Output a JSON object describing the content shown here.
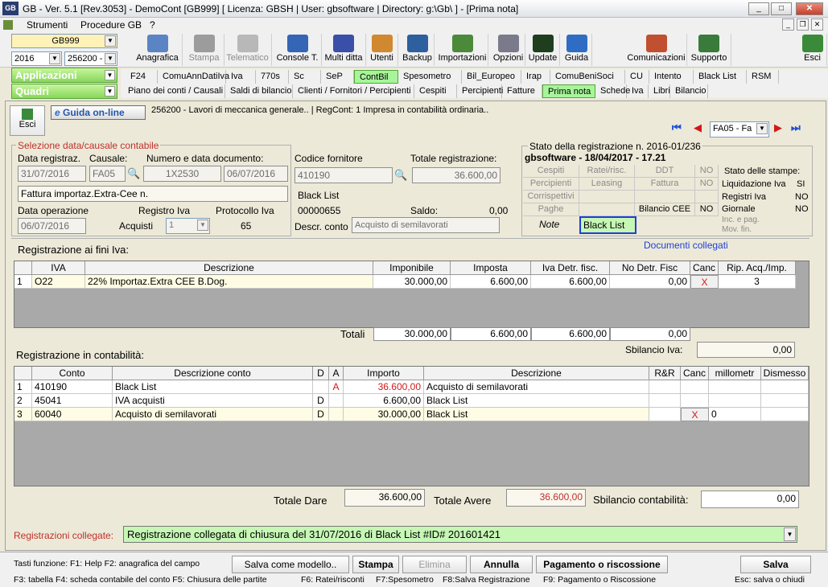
{
  "window": {
    "title": "GB - Ver. 5.1 [Rev.3053] - DemoCont [GB999]    [ Licenza: GBSH | User: gbsoftware | Directory: g:\\Gb\\ ] - [Prima nota]",
    "logo": "GB",
    "minimize": "_",
    "maximize": "□",
    "close": "✕"
  },
  "menu": {
    "items": [
      "Strumenti",
      "Procedure GB",
      "?"
    ],
    "inner_min": "_",
    "inner_restore": "❐",
    "inner_close": "✕"
  },
  "toolbar": {
    "company": "GB999",
    "year": "2016",
    "code": "256200 -",
    "buttons": [
      {
        "label": "Anagrafica",
        "enabled": true,
        "color": "#5b84c4",
        "icon": "id-card-icon"
      },
      {
        "label": "Stampa",
        "enabled": false,
        "color": "#9c9c9c",
        "icon": "printer-icon"
      },
      {
        "label": "Telematico",
        "enabled": false,
        "color": "#b8b8b8",
        "icon": "quill-icon"
      },
      {
        "label": "Console T.",
        "enabled": true,
        "color": "#3565b5",
        "icon": "console-icon"
      },
      {
        "label": "Multi ditta",
        "enabled": true,
        "color": "#3a4fa8",
        "icon": "multi-company-icon"
      },
      {
        "label": "Utenti",
        "enabled": true,
        "color": "#d0892f",
        "icon": "users-icon"
      },
      {
        "label": "Backup",
        "enabled": true,
        "color": "#2e5f9e",
        "icon": "backup-icon"
      },
      {
        "label": "Importazioni",
        "enabled": true,
        "color": "#4a8a3a",
        "icon": "import-icon"
      },
      {
        "label": "Opzioni",
        "enabled": true,
        "color": "#7a7a8a",
        "icon": "wrench-icon"
      },
      {
        "label": "Update",
        "enabled": true,
        "color": "#1e3e1e",
        "icon": "update-icon"
      },
      {
        "label": "Guida",
        "enabled": true,
        "color": "#2f6dc4",
        "icon": "help-icon"
      },
      {
        "label": "Comunicazioni",
        "enabled": true,
        "color": "#c05030",
        "icon": "communications-icon"
      },
      {
        "label": "Supporto",
        "enabled": true,
        "color": "#3a7a3a",
        "icon": "support-icon"
      },
      {
        "label": "Esci",
        "enabled": true,
        "color": "#3a8a3a",
        "icon": "exit-icon"
      }
    ]
  },
  "nav": {
    "applicazioni": "Applicazioni",
    "quadri": "Quadri",
    "row1": [
      "F24",
      "ComuAnnDatiIva",
      "Iva",
      "770s",
      "Sc",
      "SeP",
      "ContBil",
      "Spesometro",
      "Bil_Europeo",
      "Irap",
      "ComuBeniSoci",
      "CU",
      "Intento",
      "Black List",
      "RSM"
    ],
    "row2": [
      "Piano dei conti / Causali",
      "Saldi di bilancio",
      "Clienti / Fornitori / Percipienti",
      "Cespiti",
      "Percipienti",
      "Fatture",
      "Prima nota",
      "Schede",
      "Iva",
      "Libri",
      "Bilancio"
    ]
  },
  "header": {
    "esci": "Esci",
    "guida": "Guida on-line",
    "info": "256200 - Lavori di meccanica generale.. | RegCont: 1 Impresa  in contabilità ordinaria..",
    "nav_value": "FA05 - Fa"
  },
  "sel": {
    "section": "Selezione data/causale contabile",
    "data_reg_label": "Data registraz.",
    "data_reg": "31/07/2016",
    "causale_label": "Causale:",
    "causale": "FA05",
    "num_doc_label": "Numero e data documento:",
    "num_doc": "1X2530",
    "data_doc": "06/07/2016",
    "descr": "Fattura importaz.Extra-Cee n.",
    "data_op_label": "Data operazione",
    "data_op": "06/07/2016",
    "reg_iva_label": "Registro Iva",
    "reg_iva_name": "Acquisti",
    "reg_iva_num": "1",
    "protocollo_label": "Protocollo Iva",
    "protocollo": "65"
  },
  "fornitore": {
    "codice_label": "Codice fornitore",
    "codice": "410190",
    "totale_label": "Totale registrazione:",
    "totale": "36.600,00",
    "nome": "Black List",
    "conto": "00000655",
    "saldo_label": "Saldo:",
    "saldo": "0,00",
    "descr_conto_label": "Descr. conto",
    "descr_conto": "Acquisto di semilavorati"
  },
  "stato": {
    "title": "Stato della registrazione n. 2016-01/236",
    "sub": "gbsoftware - 18/04/2017 - 17.21",
    "cells": [
      "Cespiti",
      "Ratei/risc.",
      "DDT",
      "NO",
      "Percipienti",
      "Leasing",
      "Fattura",
      "NO",
      "Corrispettivi",
      "",
      "",
      "",
      "Paghe",
      "",
      "Bilancio CEE",
      "NO"
    ],
    "note": "Note",
    "black_list": "Black List",
    "stampe_title": "Stato delle stampe:",
    "stampe": [
      {
        "k": "Liquidazione Iva",
        "v": "SI"
      },
      {
        "k": "Registri Iva",
        "v": "NO"
      },
      {
        "k": "Giornale",
        "v": "NO"
      }
    ],
    "inc": "Inc. e pag.",
    "mov": "Mov. fin."
  },
  "iva": {
    "title": "Registrazione ai fini Iva:",
    "documenti": "Documenti collegati",
    "headers": [
      "IVA",
      "Descrizione",
      "Imponibile",
      "Imposta",
      "Iva Detr. fisc.",
      "No Detr. Fisc",
      "Canc",
      "Rip. Acq./Imp."
    ],
    "rows": [
      {
        "n": "1",
        "iva": "O22",
        "descr": "22% Importaz.Extra CEE B.Dog.",
        "imponibile": "30.000,00",
        "imposta": "6.600,00",
        "detr": "6.600,00",
        "nodetr": "0,00",
        "canc": "X",
        "rip": "3"
      }
    ],
    "totali_label": "Totali",
    "totali": [
      "30.000,00",
      "6.600,00",
      "6.600,00",
      "0,00"
    ],
    "sbilancio_label": "Sbilancio Iva:",
    "sbilancio": "0,00"
  },
  "cont": {
    "title": "Registrazione in contabilità:",
    "headers": [
      "Conto",
      "Descrizione conto",
      "D",
      "A",
      "Importo",
      "Descrizione",
      "R&R",
      "Canc",
      "millometr",
      "Dismesso"
    ],
    "rows": [
      {
        "n": "1",
        "conto": "410190",
        "descr_conto": "Black List",
        "d": "",
        "a": "A",
        "importo": "36.600,00",
        "descr": "Acquisto di semilavorati",
        "canc": "",
        "mill": ""
      },
      {
        "n": "2",
        "conto": "45041",
        "descr_conto": "IVA acquisti",
        "d": "D",
        "a": "",
        "importo": "6.600,00",
        "descr": "Black List",
        "canc": "",
        "mill": ""
      },
      {
        "n": "3",
        "conto": "60040",
        "descr_conto": "Acquisto di semilavorati",
        "d": "D",
        "a": "",
        "importo": "30.000,00",
        "descr": "Black List",
        "canc": "X",
        "mill": "0"
      }
    ],
    "dare_label": "Totale Dare",
    "dare": "36.600,00",
    "avere_label": "Totale Avere",
    "avere": "36.600,00",
    "sbil_label": "Sbilancio contabilità:",
    "sbil": "0,00"
  },
  "collegate": {
    "label": "Registrazioni collegate:",
    "value": "Registrazione collegata di chiusura del 31/07/2016 di Black List  #ID# 201601421"
  },
  "footer": {
    "tasti1": "Tasti funzione: F1: Help  F2: anagrafica del campo",
    "tasti2": "F3: tabella   F4: scheda contabile del conto  F5: Chiusura delle partite",
    "f6": "F6: Ratei/risconti",
    "f7": "F7:Spesometro",
    "f8": "F8:Salva Registrazione",
    "f9": "F9: Pagamento o Riscossione",
    "esc": "Esc: salva o chiudi",
    "salva_modello": "Salva come modello..",
    "stampa": "Stampa",
    "elimina": "Elimina",
    "annulla": "Annulla",
    "pagamento": "Pagamento o riscossione",
    "salva": "Salva"
  }
}
